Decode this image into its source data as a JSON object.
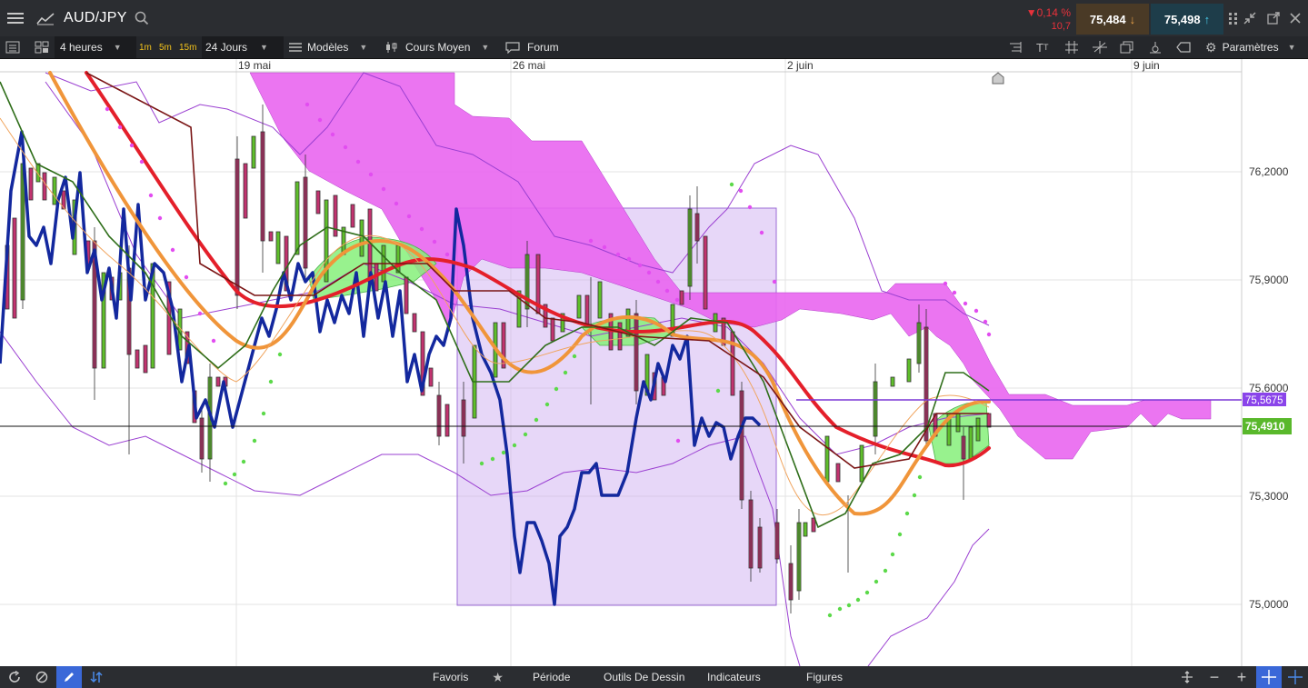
{
  "header": {
    "symbol": "AUD/JPY",
    "change_pct": "▼0,14 %",
    "change_pts": "10,7",
    "sell_price": "75,484",
    "buy_price": "75,498"
  },
  "toolbar": {
    "interval": "4 heures",
    "tf_1m": "1m",
    "tf_5m": "5m",
    "tf_15m": "15m",
    "range": "24 Jours",
    "models": "Modèles",
    "chart_type": "Cours Moyen",
    "forum": "Forum",
    "settings": "Paramètres"
  },
  "chart": {
    "date_labels": [
      "19 mai",
      "26 mai",
      "2 juin",
      "9 juin"
    ],
    "price_labels": [
      "76,2000",
      "75,9000",
      "75,6000",
      "75,3000",
      "75,0000"
    ],
    "current_price": "75,4910",
    "horizontal_line_price": "75,5675",
    "colors": {
      "bull": "#5fbf2b",
      "bear": "#c2336f",
      "cloud": "#e966f0",
      "green_cloud": "#86f07a",
      "blue_line": "#13289e",
      "red_line": "#e41f2a",
      "orange_line": "#f0953a"
    }
  },
  "bottombar": {
    "favorites": "Favoris",
    "period": "Période",
    "drawing_tools": "Outils De Dessin",
    "indicators": "Indicateurs",
    "figures": "Figures"
  }
}
